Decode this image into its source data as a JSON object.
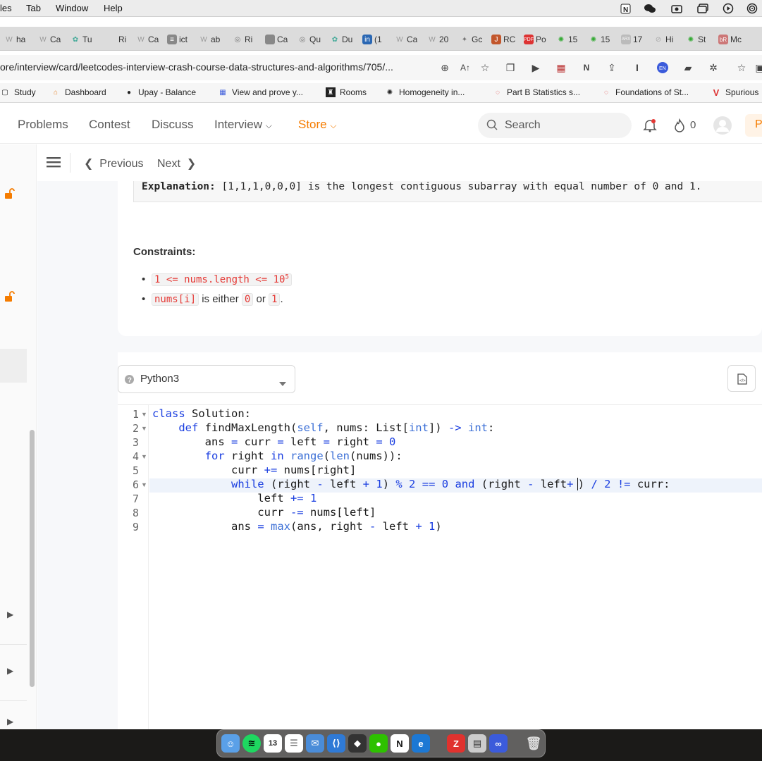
{
  "menubar": {
    "items": [
      "les",
      "Tab",
      "Window",
      "Help"
    ]
  },
  "tabs": [
    "ha",
    "Ca",
    "Tu",
    "Ri",
    "Ca",
    "ict",
    "ab",
    "Ri",
    "Ca",
    "Qu",
    "Du",
    "(1",
    "Ca",
    "20",
    "Gc",
    "RC",
    "Po",
    "15",
    "15",
    "17",
    "Hi",
    "St",
    "Mc"
  ],
  "browser": {
    "url": "ore/interview/card/leetcodes-interview-crash-course-data-structures-and-algorithms/705/..."
  },
  "bookmarks": [
    {
      "label": "Study",
      "icon": "folder-icon"
    },
    {
      "label": "Dashboard",
      "icon": "dashboard-icon"
    },
    {
      "label": "Upay - Balance",
      "icon": "upay-icon"
    },
    {
      "label": "View and prove y...",
      "icon": "shield-icon"
    },
    {
      "label": "Rooms",
      "icon": "rooms-icon"
    },
    {
      "label": "Homogeneity in...",
      "icon": "openai-icon"
    },
    {
      "label": "Part B Statistics s...",
      "icon": "dotted-circle-icon"
    },
    {
      "label": "Foundations of St...",
      "icon": "dotted-circle-icon"
    },
    {
      "label": "Spurious",
      "icon": "v-icon"
    }
  ],
  "nav": {
    "problems": "Problems",
    "contest": "Contest",
    "discuss": "Discuss",
    "interview": "Interview",
    "store": "Store",
    "search_placeholder": "Search",
    "streak_count": "0",
    "premium_letter": "P"
  },
  "subheader": {
    "previous": "Previous",
    "next": "Next"
  },
  "problem": {
    "explanation_label": "Explanation:",
    "explanation_text": " [1,1,1,0,0,0] is the longest contiguous subarray with equal number of 0 and 1.",
    "constraints_title": "Constraints:",
    "c1_code": "1 <= nums.length <= 10",
    "c1_exp": "5",
    "c2_code": "nums[i]",
    "c2_text_a": "is either",
    "c2_zero": "0",
    "c2_or": "or",
    "c2_one": "1",
    "c2_end": "."
  },
  "editor": {
    "language": "Python3",
    "line_numbers": [
      "1",
      "2",
      "3",
      "4",
      "5",
      "6",
      "7",
      "8",
      "9"
    ]
  },
  "colors": {
    "accent_orange": "#f57c00",
    "keyword_blue": "#1a3ee0",
    "inline_code_red": "#e53935"
  }
}
